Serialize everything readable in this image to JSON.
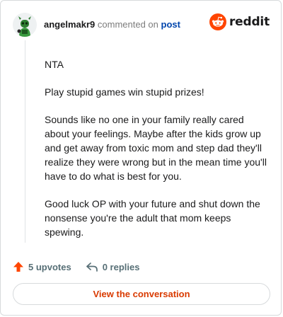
{
  "header": {
    "username": "angelmakr9",
    "action_text": "commented on",
    "target_link": "post",
    "logo_text": "reddit"
  },
  "comment": {
    "paragraphs": [
      "NTA",
      "Play stupid games win stupid prizes!",
      "Sounds like no one in your family really cared about your feelings. Maybe after the kids grow up and get away from toxic mom and step dad they'll realize they were wrong but in the mean time you'll have to do what is best for you.",
      "Good luck OP with your future and shut down the nonsense you're the adult that mom keeps spewing."
    ]
  },
  "footer": {
    "upvotes_label": "5 upvotes",
    "replies_label": "0 replies"
  },
  "cta": {
    "label": "View the conversation"
  },
  "colors": {
    "brand": "#ff4500",
    "cta_text": "#d93a00",
    "link": "#0045ac"
  },
  "icons": {
    "avatar": "snoo-avatar-icon",
    "logo": "reddit-snoo-icon",
    "upvote": "upvote-arrow-icon",
    "reply": "reply-arrow-icon"
  }
}
